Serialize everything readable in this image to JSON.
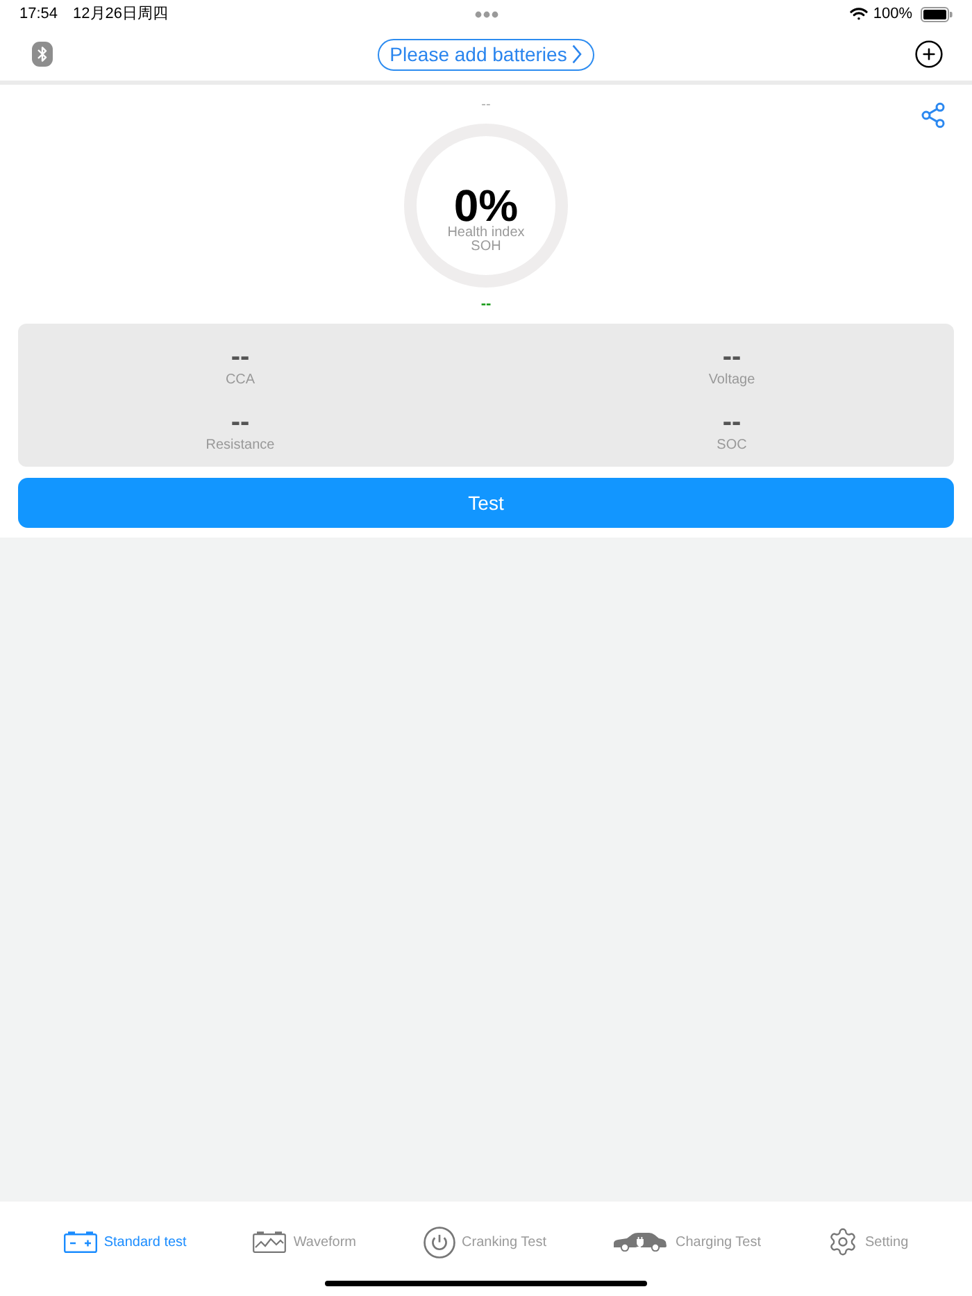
{
  "status_bar": {
    "time": "17:54",
    "date": "12月26日周四",
    "battery": "100%"
  },
  "header": {
    "add_button": "Please add batteries"
  },
  "health": {
    "top_reading": "--",
    "value": "0%",
    "label": "Health index",
    "sublabel": "SOH",
    "bottom_reading": "--"
  },
  "metrics": [
    {
      "value": "--",
      "label": "CCA"
    },
    {
      "value": "--",
      "label": "Voltage"
    },
    {
      "value": "--",
      "label": "Resistance"
    },
    {
      "value": "--",
      "label": "SOC"
    }
  ],
  "test_button": "Test",
  "tabs": [
    {
      "label": "Standard test",
      "selected": true,
      "kind": "battery"
    },
    {
      "label": "Waveform",
      "selected": false,
      "kind": "waveform"
    },
    {
      "label": "Cranking Test",
      "selected": false,
      "kind": "power"
    },
    {
      "label": "Charging Test",
      "selected": false,
      "kind": "car"
    },
    {
      "label": "Setting",
      "selected": false,
      "kind": "gear"
    }
  ]
}
